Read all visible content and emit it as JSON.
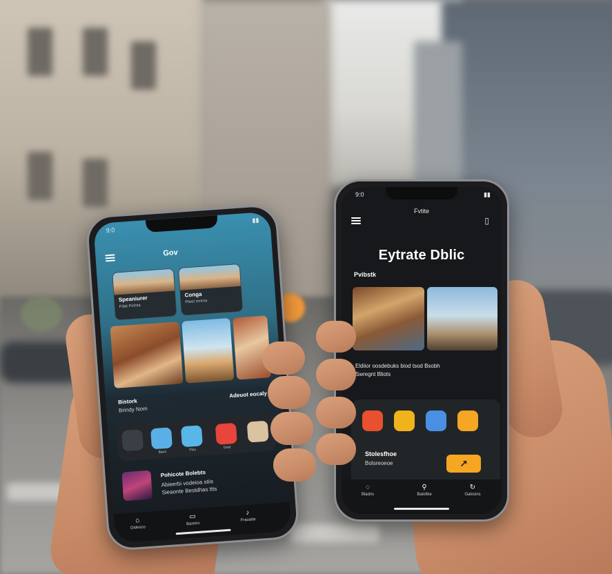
{
  "left_phone": {
    "status_time": "9:0",
    "title": "Gov",
    "cards": [
      {
        "title": "Speaniurer",
        "subtitle": "Pdat Pinhta"
      },
      {
        "title": "Conga",
        "subtitle": "Pleet mnma"
      }
    ],
    "section_left": "Bistork",
    "section_left_sub": "Brindy Nom",
    "section_right": "Adeuot eocaly",
    "apps": [
      {
        "icon": "photos-icon",
        "label": "",
        "color": "#3a3f45"
      },
      {
        "icon": "files-icon",
        "label": "Baun",
        "color": "#5ab0e6"
      },
      {
        "icon": "chat-icon",
        "label": "Flnu",
        "color": "#58b6e8"
      },
      {
        "icon": "tv-icon",
        "label": "Doid",
        "color": "#e8453c"
      },
      {
        "icon": "gallery-icon",
        "label": "",
        "color": "#d9c3a1"
      }
    ],
    "feature_title": "Pohicote Bolebts",
    "feature_lines": [
      "Abieerbi vodeioa stiis",
      "Sieaonte Bestdhas ttts"
    ],
    "tabs": [
      {
        "icon": "home-icon",
        "label": "Didesco"
      },
      {
        "icon": "book-icon",
        "label": "Bareiro"
      },
      {
        "icon": "mic-icon",
        "label": "Fraoaite"
      }
    ]
  },
  "right_phone": {
    "status_time": "9:0",
    "status_title": "Fvtite",
    "title": "Eytrate Dblic",
    "section": "Pvibstk",
    "para_lines": [
      "Eldiior oosdebuks biod tsod Bsobh",
      "Swregnt Bliots"
    ],
    "apps": [
      {
        "icon": "refresh-icon",
        "color": "#e8502f"
      },
      {
        "icon": "folder-icon",
        "color": "#f0b31c"
      },
      {
        "icon": "chat-icon",
        "color": "#4a90e2"
      },
      {
        "icon": "doc-icon",
        "color": "#f5a623"
      }
    ],
    "promo_title": "Stolesfhoe",
    "promo_sub": "Bolsreoeoe",
    "promo_button_glyph": "↗",
    "tabs": [
      {
        "icon": "home-icon",
        "label": "Bladns"
      },
      {
        "icon": "pin-icon",
        "label": "Baloltke"
      },
      {
        "icon": "refresh-icon",
        "label": "Galosins"
      }
    ]
  }
}
